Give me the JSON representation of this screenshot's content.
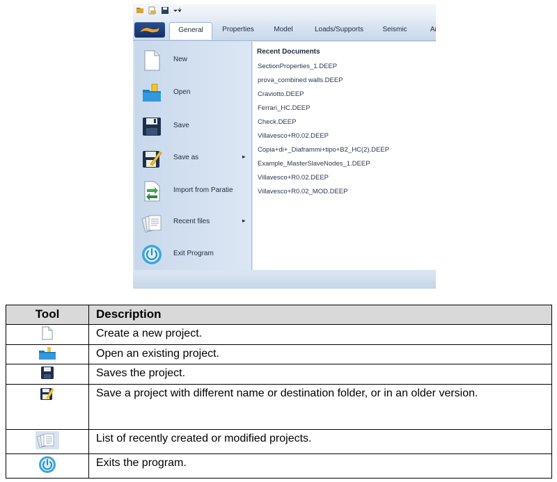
{
  "menu": {
    "tabs": [
      "General",
      "Properties",
      "Model",
      "Loads/Supports",
      "Seismic",
      "An"
    ],
    "active_tab": "General",
    "items": [
      {
        "label": "New",
        "icon": "new-document-icon",
        "arrow": ""
      },
      {
        "label": "Open",
        "icon": "open-folder-icon",
        "arrow": ""
      },
      {
        "label": "Save",
        "icon": "floppy-disk-icon",
        "arrow": ""
      },
      {
        "label": "Save as",
        "icon": "save-as-icon",
        "arrow": "▸"
      },
      {
        "label": "Import from Paratie",
        "icon": "import-icon",
        "arrow": ""
      },
      {
        "label": "Recent files",
        "icon": "recent-files-icon",
        "arrow": "▸"
      },
      {
        "label": "Exit Program",
        "icon": "power-icon",
        "arrow": ""
      }
    ],
    "recent_title": "Recent Documents",
    "recent_documents": [
      "SectionProperties_1.DEEP",
      "prova_combined walls.DEEP",
      "Craviotto.DEEP",
      "Ferrari_HC.DEEP",
      "Check.DEEP",
      "Villavesco+R0.02.DEEP",
      "Copia+di+_Diaframmi+tipo+B2_HC(2).DEEP",
      "Example_MasterSlaveNodes_1.DEEP",
      "Villavesco+R0.02.DEEP",
      "Villavesco+R0.02_MOD.DEEP"
    ]
  },
  "table": {
    "headers": {
      "tool": "Tool",
      "description": "Description"
    },
    "rows": [
      {
        "icon": "new-document-icon",
        "description": "Create a new project."
      },
      {
        "icon": "open-folder-icon",
        "description": "Open an existing project."
      },
      {
        "icon": "floppy-disk-icon",
        "description": "Saves the project."
      },
      {
        "icon": "save-as-icon",
        "description": "Save a project with different name or destination folder, or in an older version."
      },
      {
        "icon": "recent-files-icon",
        "description": "List of recently created or modified projects."
      },
      {
        "icon": "power-icon",
        "description": "Exits the program."
      }
    ]
  },
  "colors": {
    "menu_blue": "#d7e4f2",
    "header_gray": "#d9d9d9",
    "folder_blue": "#1f7fc4",
    "power_blue": "#3fa6d8"
  }
}
